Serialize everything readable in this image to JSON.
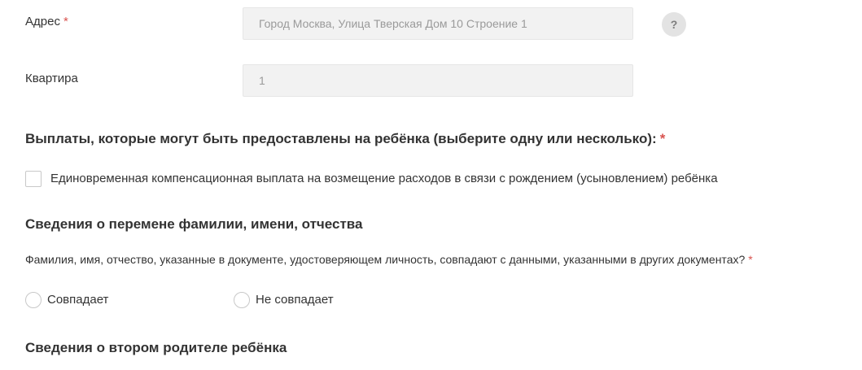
{
  "address": {
    "label": "Адрес",
    "required_mark": "*",
    "value": "Город Москва, Улица Тверская Дом 10 Строение 1",
    "help": "?"
  },
  "apartment": {
    "label": "Квартира",
    "value": "1"
  },
  "payments": {
    "heading": "Выплаты, которые могут быть предоставлены на ребёнка (выберите одну или несколько):",
    "required_mark": "*",
    "options": [
      {
        "label": "Единовременная компенсационная выплата на возмещение расходов в связи с рождением (усыновлением) ребёнка",
        "checked": false
      }
    ]
  },
  "name_change": {
    "heading": "Сведения о перемене фамилии, имени, отчества",
    "question": "Фамилия, имя, отчество, указанные в документе, удостоверяющем личность, совпадают с данными, указанными в других документах?",
    "required_mark": "*",
    "options": [
      {
        "label": "Совпадает",
        "selected": false
      },
      {
        "label": "Не совпадает",
        "selected": false
      }
    ]
  },
  "second_parent": {
    "heading": "Сведения о втором родителе ребёнка"
  },
  "colors": {
    "required": "#d9534f",
    "input_bg": "#f2f2f2",
    "text": "#333333",
    "placeholder_text": "#9a9a9a"
  }
}
